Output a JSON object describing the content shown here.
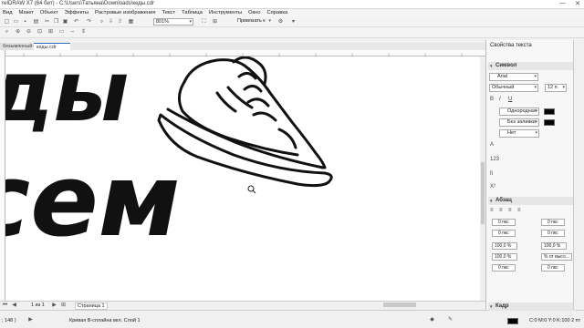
{
  "window": {
    "title": "reIDRAW X7 (64 бит) - C:\\Users\\Татьяна\\Downloads\\кеды.cdr",
    "minimize": "—",
    "close": "✕"
  },
  "menu": [
    "Вид",
    "Макет",
    "Объект",
    "Эффекты",
    "Растровые изображения",
    "Текст",
    "Таблица",
    "Инструменты",
    "Окно",
    "Справка"
  ],
  "toolbar": {
    "zoom_value": "801%",
    "snap_label": "Привязать к"
  },
  "tabs": {
    "tab1": "безымянный-1",
    "tab2": "кеды.cdr"
  },
  "canvas": {
    "text_line1": "ды",
    "text_line2": "сем"
  },
  "pagebar": {
    "page_count": "1 из 1",
    "page_name": "Страница 1"
  },
  "status": {
    "coords": "; 148 )",
    "object_info": "Кривая В-сплайна вкл. Слой 1",
    "fill_info": "C:0 M:0 Y:0 K:100  2 пт"
  },
  "docker": {
    "title": "Свойства текста",
    "section_symbol": "Символ",
    "font": "Arial",
    "style": "Обычный",
    "size": "12 п.",
    "fill_type": "Однородная ...",
    "bg_fill": "Без заливки",
    "outline": "Нет",
    "section_para": "Абзац",
    "indent1": "0 пкс",
    "indent2": "0 пкс",
    "indent3": "0 пкс",
    "indent4": "0 пкс",
    "spacing1": "100,0 %",
    "spacing2": "100,0 %",
    "spacing3": "100,0 %",
    "spacing_mode": "% от высо...",
    "spacing4": "0 пкс",
    "spacing5": "0 пкс",
    "section_frame": "Кадр"
  },
  "colors": {
    "accent": "#2a6ebb",
    "ink": "#111111"
  }
}
